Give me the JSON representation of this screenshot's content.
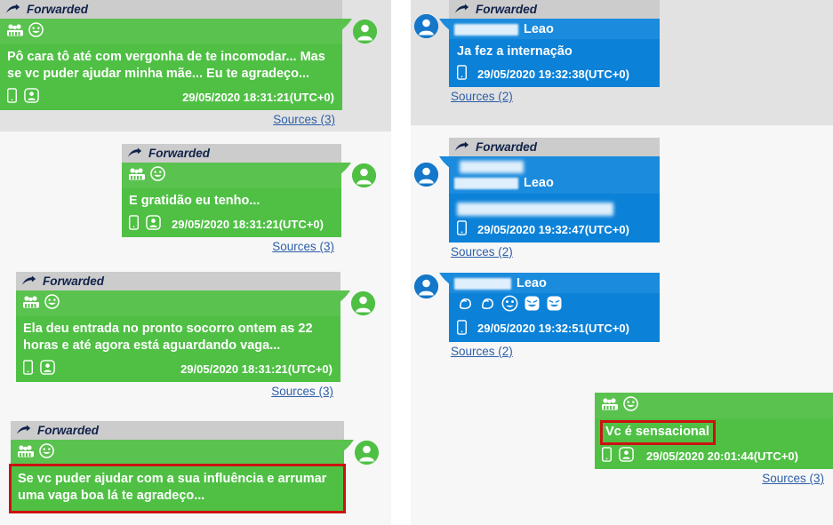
{
  "app": {
    "forwarded_label": "Forwarded",
    "sources_3": "Sources (3)",
    "sources_2": "Sources (2)",
    "link_color": "#2d5fa8",
    "outgoing_color": "#4fc044",
    "incoming_color": "#0b81d8",
    "highlight_color": "#cc1111",
    "forwarded_bar_color": "#cccccc",
    "row_shade_color": "#e2e2e2",
    "row_plain_color": "#f7f7f7"
  },
  "left_panel": {
    "messages": [
      {
        "id": "msg-left-1",
        "direction": "outgoing",
        "forwarded": true,
        "header_icons": [
          "group-icon",
          "grinning-face-emoji"
        ],
        "text": "Pô cara tô até com vergonha de te incomodar... Mas se vc puder ajudar minha mãe... Eu te agradeço...",
        "meta_icons": [
          "phone-icon",
          "contacts-icon"
        ],
        "timestamp": "29/05/2020 18:31:21(UTC+0)",
        "sources": "Sources (3)",
        "highlighted": false,
        "row_shade": true
      },
      {
        "id": "msg-left-2",
        "direction": "outgoing",
        "forwarded": true,
        "header_icons": [
          "group-icon",
          "grinning-face-emoji"
        ],
        "text": "E gratidão eu tenho...",
        "meta_icons": [
          "phone-icon",
          "contacts-icon"
        ],
        "timestamp": "29/05/2020 18:31:21(UTC+0)",
        "sources": "Sources (3)",
        "highlighted": false,
        "row_shade": false
      },
      {
        "id": "msg-left-3",
        "direction": "outgoing",
        "forwarded": true,
        "header_icons": [
          "group-icon",
          "grinning-face-emoji"
        ],
        "text": "Ela deu entrada no pronto socorro ontem as 22 horas e até agora está aguardando vaga...",
        "meta_icons": [
          "phone-icon",
          "contacts-icon"
        ],
        "timestamp": "29/05/2020 18:31:21(UTC+0)",
        "sources": "Sources (3)",
        "highlighted": false,
        "row_shade": false
      },
      {
        "id": "msg-left-4",
        "direction": "outgoing",
        "forwarded": true,
        "header_icons": [
          "group-icon",
          "grinning-face-emoji"
        ],
        "text": "Se vc puder ajudar com a sua influência e arrumar uma vaga boa lá te agradeço...",
        "meta_icons": [],
        "timestamp": "",
        "sources": "",
        "highlighted": true,
        "row_shade": false
      }
    ]
  },
  "right_panel": {
    "messages": [
      {
        "id": "msg-right-1",
        "direction": "incoming",
        "forwarded": true,
        "sender_redacted": true,
        "sender_name": "Leao",
        "text": "Ja fez a internação",
        "meta_icons": [
          "phone-icon"
        ],
        "timestamp": "29/05/2020 19:32:38(UTC+0)",
        "sources": "Sources (2)",
        "highlighted": false,
        "row_shade": true
      },
      {
        "id": "msg-right-2",
        "direction": "incoming",
        "forwarded": true,
        "sender_redacted": true,
        "sender_name": "Leao",
        "text": "",
        "body_redacted": true,
        "meta_icons": [
          "phone-icon"
        ],
        "timestamp": "29/05/2020 19:32:47(UTC+0)",
        "sources": "Sources (2)",
        "highlighted": false,
        "row_shade": false
      },
      {
        "id": "msg-right-3",
        "direction": "incoming",
        "forwarded": false,
        "sender_redacted": true,
        "sender_name": "Leao",
        "text": "",
        "emojis": "💪💪😜😂😂",
        "meta_icons": [
          "phone-icon"
        ],
        "timestamp": "29/05/2020 19:32:51(UTC+0)",
        "sources": "Sources (2)",
        "highlighted": false,
        "row_shade": false
      },
      {
        "id": "msg-right-4",
        "direction": "outgoing",
        "forwarded": false,
        "header_icons": [
          "group-icon",
          "grinning-face-emoji"
        ],
        "text": "Vc é sensacional",
        "meta_icons": [
          "phone-icon",
          "contacts-icon"
        ],
        "timestamp": "29/05/2020 20:01:44(UTC+0)",
        "sources": "Sources (3)",
        "highlighted": true,
        "row_shade": false
      }
    ]
  }
}
